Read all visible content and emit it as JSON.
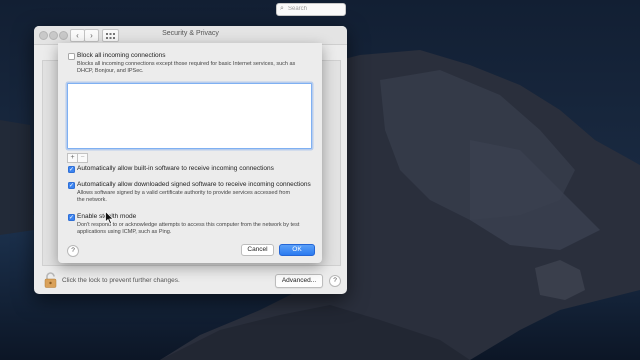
{
  "window": {
    "title": "Security & Privacy",
    "search_placeholder": "Search",
    "lock_text": "Click the lock to prevent further changes.",
    "advanced_label": "Advanced...",
    "help_label": "?"
  },
  "nav": {
    "back": "‹",
    "forward": "›"
  },
  "sheet": {
    "block_all": {
      "label": "Block all incoming connections",
      "checked": false,
      "desc_line1": "Blocks all incoming connections except those required for basic Internet services, such as",
      "desc_line2": "DHCP, Bonjour, and IPSec."
    },
    "list_add": "+",
    "list_remove": "−",
    "auto_builtin": {
      "label": "Automatically allow built-in software to receive incoming connections",
      "checked": true
    },
    "auto_signed": {
      "label": "Automatically allow downloaded signed software to receive incoming connections",
      "checked": true,
      "desc_line1": "Allows software signed by a valid certificate authority to provide services accessed from",
      "desc_line2": "the network."
    },
    "stealth": {
      "label": "Enable stealth mode",
      "checked": true,
      "desc_line1": "Don't respond to or acknowledge attempts to access this computer from the network by test",
      "desc_line2": "applications using ICMP, such as Ping."
    },
    "help_label": "?",
    "cancel_label": "Cancel",
    "ok_label": "OK"
  },
  "colors": {
    "accent": "#3c84f0",
    "window_bg": "#ececec",
    "desktop_sky": "#0f1b2e"
  }
}
